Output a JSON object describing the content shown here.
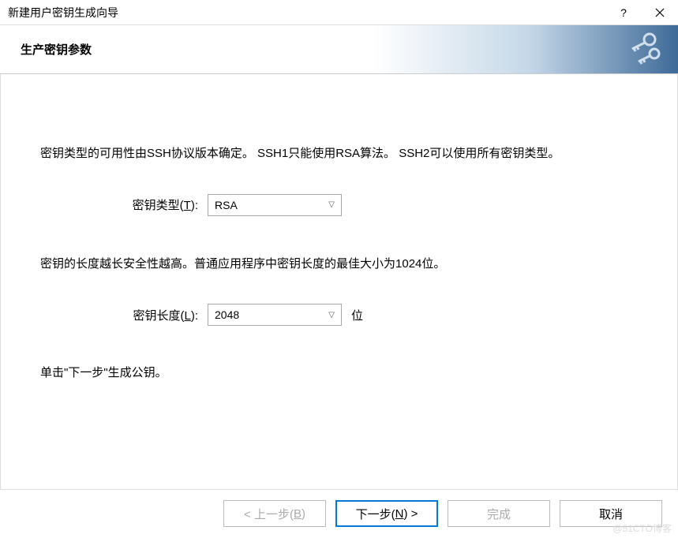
{
  "titlebar": {
    "title": "新建用户密钥生成向导"
  },
  "header": {
    "title": "生产密钥参数"
  },
  "content": {
    "desc1": "密钥类型的可用性由SSH协议版本确定。 SSH1只能使用RSA算法。 SSH2可以使用所有密钥类型。",
    "key_type_label_prefix": "密钥类型(",
    "key_type_label_hotkey": "T",
    "key_type_label_suffix": "):",
    "key_type_value": "RSA",
    "desc2": "密钥的长度越长安全性越高。普通应用程序中密钥长度的最佳大小为1024位。",
    "key_length_label_prefix": "密钥长度(",
    "key_length_label_hotkey": "L",
    "key_length_label_suffix": "):",
    "key_length_value": "2048",
    "key_length_suffix": "位",
    "hint": "单击\"下一步\"生成公钥。"
  },
  "buttons": {
    "back_prefix": "< 上一步(",
    "back_hotkey": "B",
    "back_suffix": ")",
    "next_prefix": "下一步(",
    "next_hotkey": "N",
    "next_suffix": ") >",
    "finish": "完成",
    "cancel": "取消"
  },
  "watermark": "@51CTO博客"
}
